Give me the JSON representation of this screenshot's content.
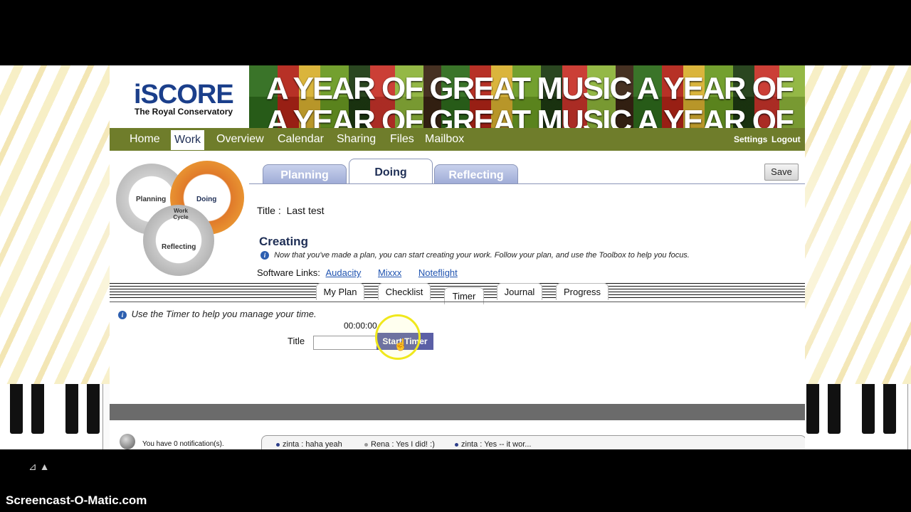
{
  "logo": {
    "main": "iSCORE",
    "sub": "The Royal Conservatory"
  },
  "banner": {
    "text": "A YEAR OF GREAT MUSIC  A YEAR OF"
  },
  "nav": {
    "items": [
      "Home",
      "Work",
      "Overview",
      "Calendar",
      "Sharing",
      "Files",
      "Mailbox"
    ],
    "active": "Work",
    "right": [
      "Settings",
      "Logout"
    ]
  },
  "cycle": {
    "planning": "Planning",
    "doing": "Doing",
    "reflecting": "Reflecting",
    "center": "Work Cycle"
  },
  "phase_tabs": [
    "Planning",
    "Doing",
    "Reflecting"
  ],
  "active_phase": "Doing",
  "save_label": "Save",
  "title": {
    "label": "Title :",
    "value": "Last test"
  },
  "section": {
    "heading": "Creating",
    "info": "Now that you've made a plan, you can start creating your work. Follow your plan, and use the Toolbox to help you focus.",
    "links_label": "Software Links:",
    "links": [
      "Audacity",
      "Mixxx",
      "Noteflight"
    ]
  },
  "sub_tabs": [
    "My Plan",
    "Checklist",
    "Timer",
    "Journal",
    "Progress"
  ],
  "active_sub_tab": "Timer",
  "timer": {
    "info": "Use the Timer to help you manage your time.",
    "display": "00:00:00",
    "title_label": "Title",
    "title_value": "",
    "start_label": "Start Timer"
  },
  "notifications": {
    "text": "You have 0 notification(s)."
  },
  "chat": [
    "zinta : haha yeah",
    "Rena : Yes I did! :)",
    "zinta : Yes -- it wor..."
  ],
  "watermark": "Screencast-O-Matic.com",
  "colors": {
    "nav_bg": "#6f7d2b",
    "tab_blue": "#9eabd6",
    "button": "#5b5fa6",
    "heading": "#1e2e55",
    "link": "#1f53b0"
  }
}
